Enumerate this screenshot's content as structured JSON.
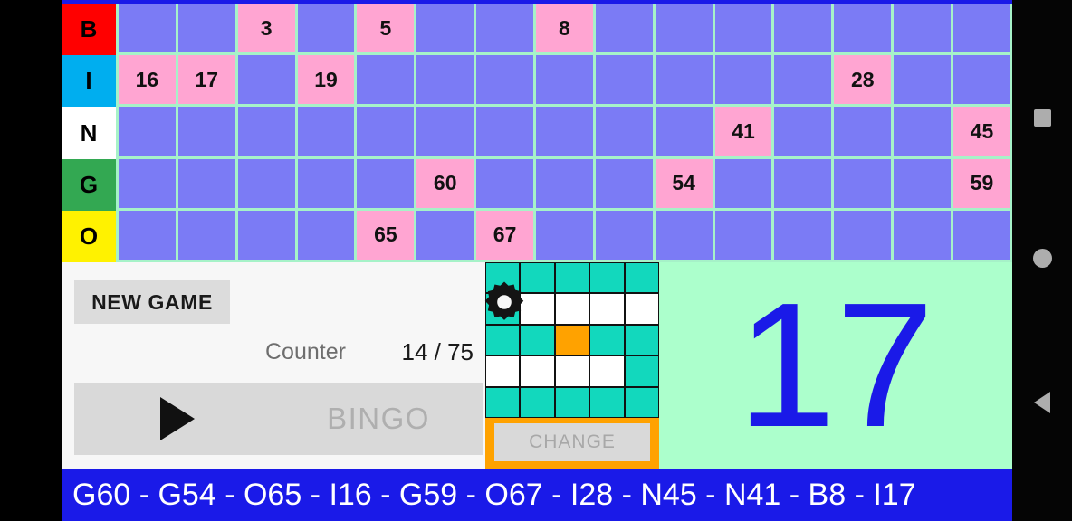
{
  "board": {
    "columns": 15,
    "rows": [
      {
        "letter": "B",
        "header_color": "#FF0000",
        "marked": [
          3,
          5,
          8
        ]
      },
      {
        "letter": "I",
        "header_color": "#00AEEF",
        "marked": [
          16,
          17,
          19,
          28
        ]
      },
      {
        "letter": "N",
        "header_color": "#FFFFFF",
        "marked": [
          41,
          45
        ]
      },
      {
        "letter": "G",
        "header_color": "#33A852",
        "marked": [
          60,
          54,
          59
        ]
      },
      {
        "letter": "O",
        "header_color": "#FFF200",
        "marked": [
          65,
          67
        ]
      }
    ],
    "cells": [
      [
        "",
        "",
        "3",
        "",
        "5",
        "",
        "",
        "8",
        "",
        "",
        "",
        "",
        "",
        "",
        ""
      ],
      [
        "16",
        "17",
        "",
        "19",
        "",
        "",
        "",
        "",
        "",
        "",
        "",
        "",
        "28",
        "",
        ""
      ],
      [
        "",
        "",
        "",
        "",
        "",
        "",
        "",
        "",
        "",
        "",
        "41",
        "",
        "",
        "",
        "45"
      ],
      [
        "",
        "",
        "",
        "",
        "",
        "60",
        "",
        "",
        "",
        "54",
        "",
        "",
        "",
        "",
        "59"
      ],
      [
        "",
        "",
        "",
        "",
        "65",
        "",
        "67",
        "",
        "",
        "",
        "",
        "",
        "",
        "",
        ""
      ]
    ],
    "marked_color": "#FFA5D2",
    "unmarked_color": "#7B7BF5",
    "gridline_color": "#A6F2C8"
  },
  "controls": {
    "new_game_label": "NEW GAME",
    "gear_icon": "gear-icon",
    "counter_label": "Counter",
    "counter_value": "14 / 75",
    "play_icon": "play-triangle-icon",
    "bingo_label": "BINGO"
  },
  "pattern": {
    "change_label": "CHANGE",
    "frame_color": "#FFA200",
    "on_color": "#12D8BD",
    "off_color": "#FFFFFF",
    "free_color": "#FFA200",
    "grid": [
      [
        "on",
        "on",
        "on",
        "on",
        "on"
      ],
      [
        "on",
        "off",
        "off",
        "off",
        "off"
      ],
      [
        "on",
        "on",
        "free",
        "on",
        "on"
      ],
      [
        "off",
        "off",
        "off",
        "off",
        "on"
      ],
      [
        "on",
        "on",
        "on",
        "on",
        "on"
      ]
    ]
  },
  "current": {
    "number": "17",
    "background": "#ACFFCC",
    "text_color": "#1A1AE8"
  },
  "history": {
    "text": "G60 - G54 - O65 - I16 - G59 - O67 - I28 - N45 - N41 -  B8 - I17",
    "background": "#1A1AE8"
  },
  "navbar": {
    "recents": "recents-square-icon",
    "home": "home-circle-icon",
    "back": "back-triangle-icon"
  }
}
